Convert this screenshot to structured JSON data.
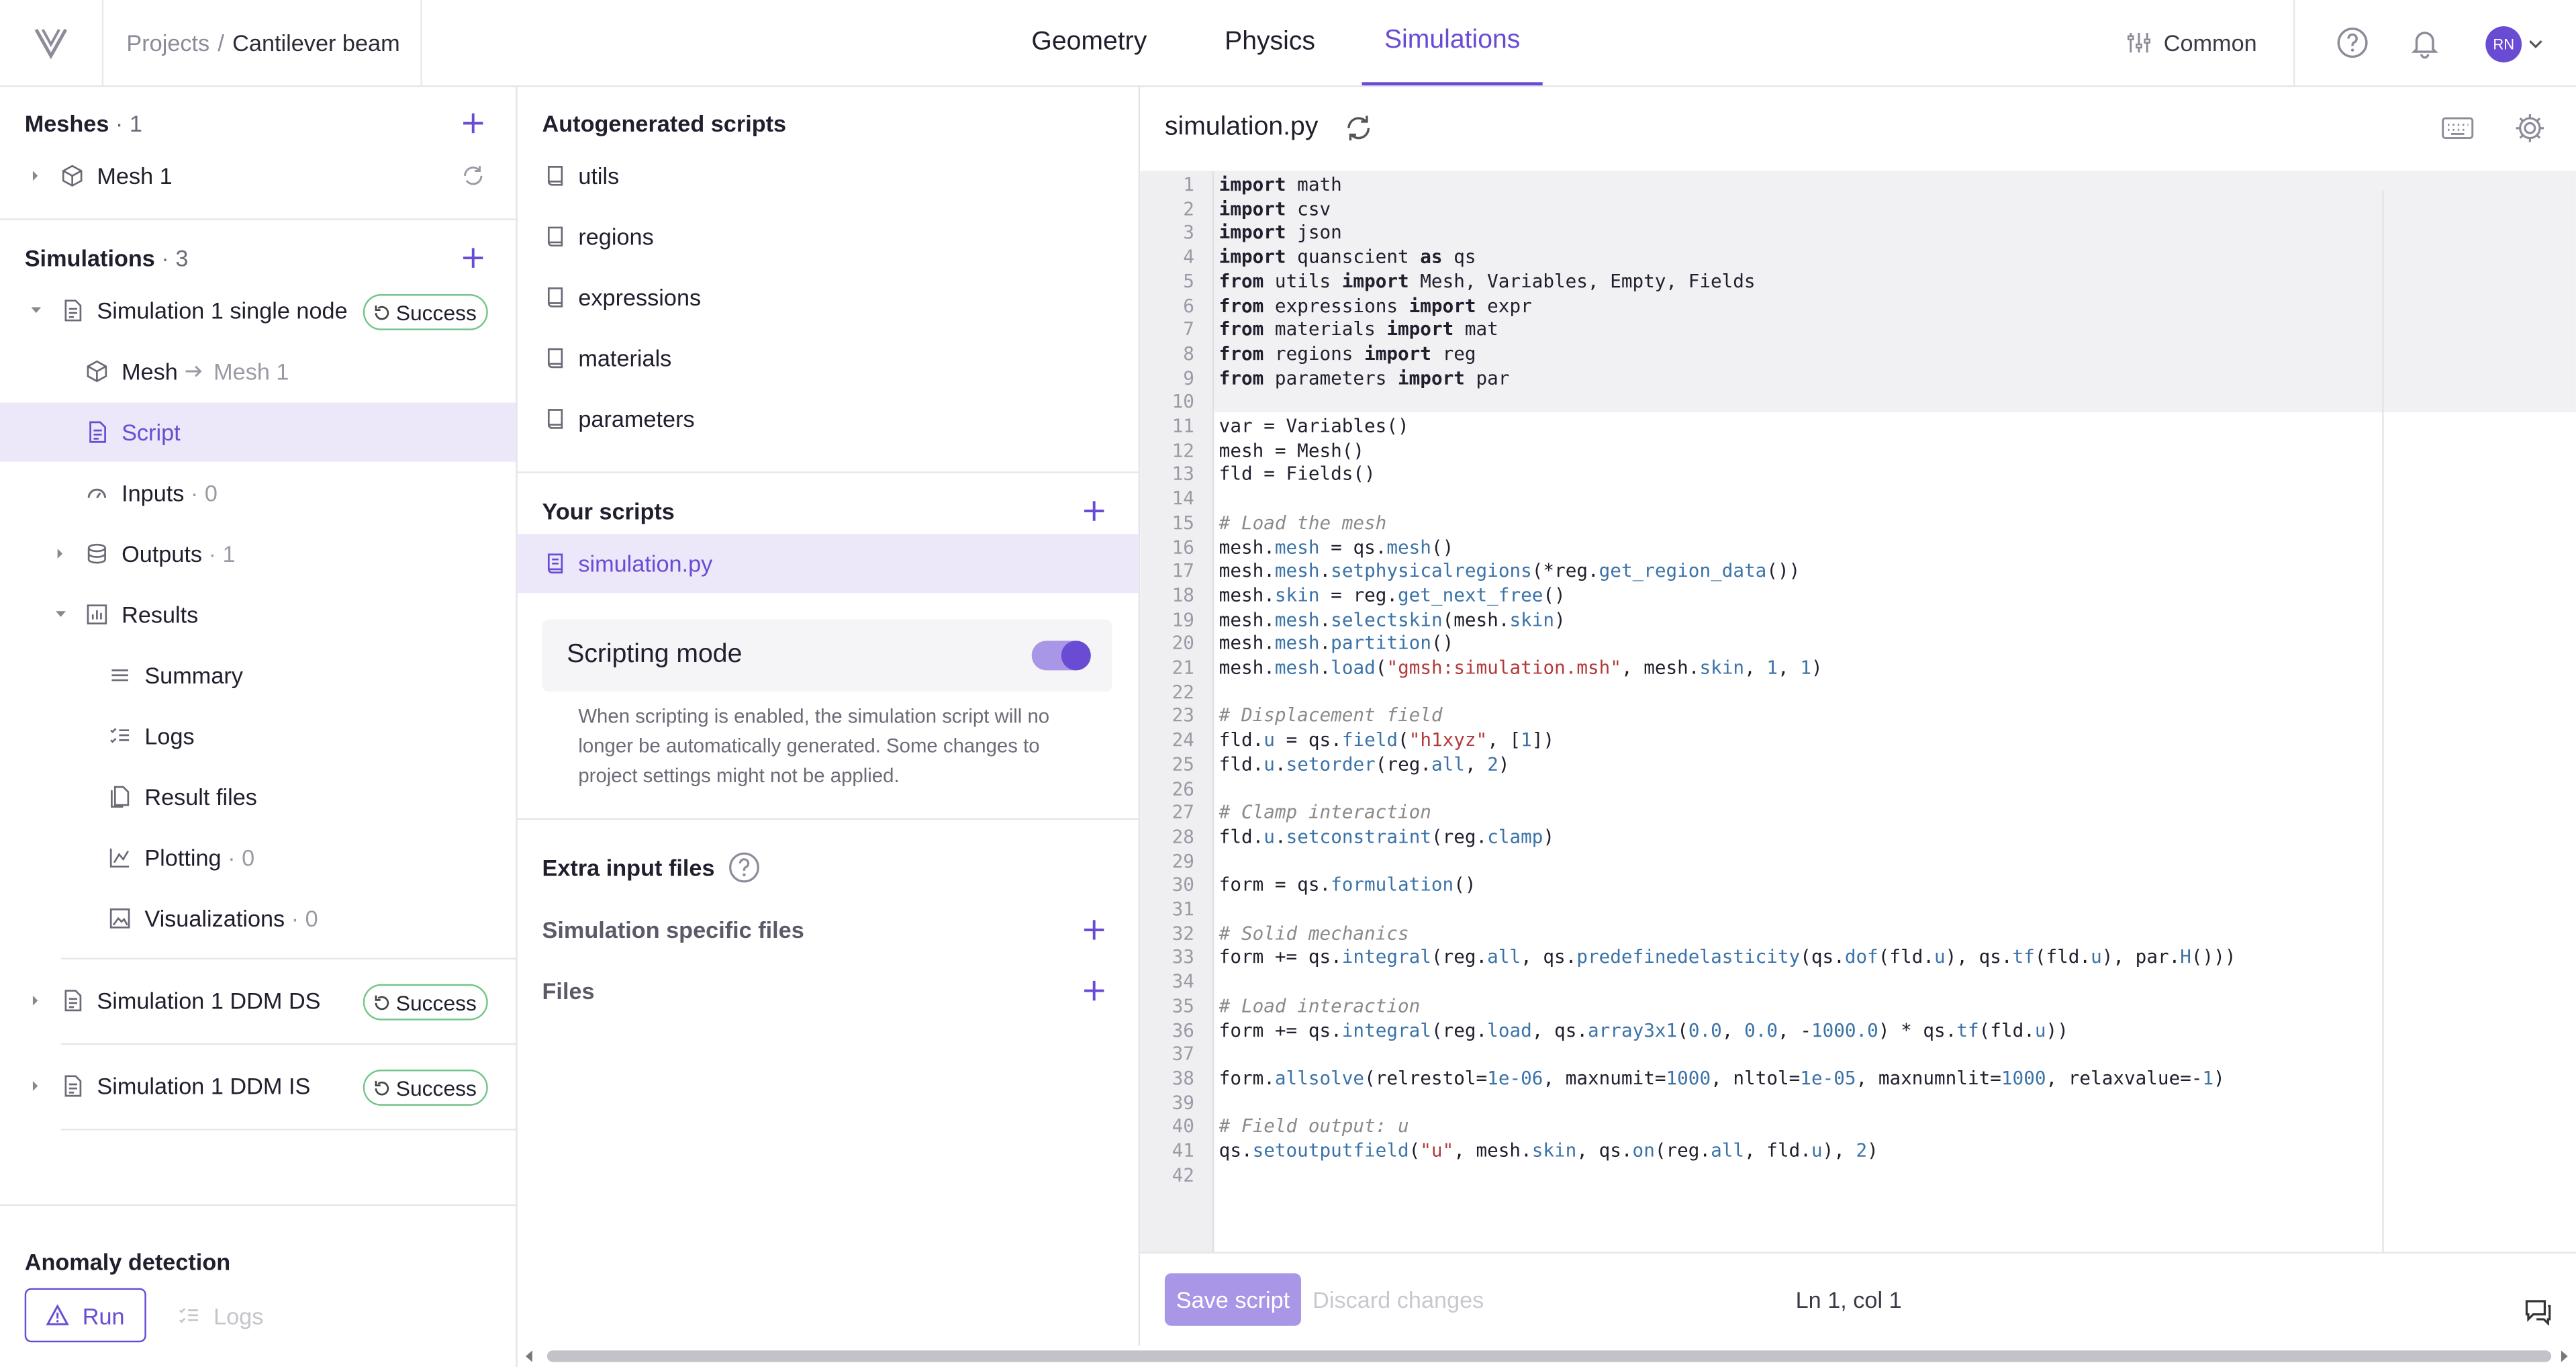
{
  "header": {
    "breadcrumb_root": "Projects",
    "breadcrumb_sep": "/",
    "breadcrumb_current": "Cantilever beam",
    "tabs": [
      "Geometry",
      "Physics",
      "Simulations"
    ],
    "active_tab": "Simulations",
    "common_label": "Common",
    "avatar_initials": "RN"
  },
  "left": {
    "meshes_title": "Meshes",
    "meshes_count": "· 1",
    "mesh_item": "Mesh 1",
    "simulations_title": "Simulations",
    "simulations_count": "· 3",
    "sim1": {
      "label": "Simulation 1 single node",
      "status": "Success",
      "mesh_label": "Mesh",
      "mesh_ref": "Mesh 1",
      "script_label": "Script",
      "inputs_label": "Inputs",
      "inputs_count": "· 0",
      "outputs_label": "Outputs",
      "outputs_count": "· 1",
      "results_label": "Results",
      "results_items": {
        "summary": "Summary",
        "logs": "Logs",
        "result_files": "Result files",
        "plotting": "Plotting",
        "plotting_count": "· 0",
        "visualizations": "Visualizations",
        "visualizations_count": "· 0"
      }
    },
    "sim2": {
      "label": "Simulation 1 DDM DS",
      "status": "Success"
    },
    "sim3": {
      "label": "Simulation 1 DDM IS",
      "status": "Success"
    },
    "anomaly_title": "Anomaly detection",
    "run_label": "Run",
    "logs_label": "Logs"
  },
  "middle": {
    "autogen_title": "Autogenerated scripts",
    "autogen_items": [
      "utils",
      "regions",
      "expressions",
      "materials",
      "parameters"
    ],
    "your_scripts_title": "Your scripts",
    "your_script_item": "simulation.py",
    "scripting_mode_label": "Scripting mode",
    "scripting_mode_on": true,
    "scripting_help": "When scripting is enabled, the simulation script will no longer be automatically generated. Some changes to project settings might not be applied.",
    "extra_title": "Extra input files",
    "sim_specific_files": "Simulation specific files",
    "files_label": "Files"
  },
  "editor": {
    "filename": "simulation.py",
    "save_label": "Save script",
    "discard_label": "Discard changes",
    "cursor_pos": "Ln 1, col 1",
    "lines": [
      "import math",
      "import csv",
      "import json",
      "import quanscient as qs",
      "from utils import Mesh, Variables, Empty, Fields",
      "from expressions import expr",
      "from materials import mat",
      "from regions import reg",
      "from parameters import par",
      "",
      "var = Variables()",
      "mesh = Mesh()",
      "fld = Fields()",
      "",
      "# Load the mesh",
      "mesh.mesh = qs.mesh()",
      "mesh.mesh.setphysicalregions(*reg.get_region_data())",
      "mesh.skin = reg.get_next_free()",
      "mesh.mesh.selectskin(mesh.skin)",
      "mesh.mesh.partition()",
      "mesh.mesh.load(\"gmsh:simulation.msh\", mesh.skin, 1, 1)",
      "",
      "# Displacement field",
      "fld.u = qs.field(\"h1xyz\", [1])",
      "fld.u.setorder(reg.all, 2)",
      "",
      "# Clamp interaction",
      "fld.u.setconstraint(reg.clamp)",
      "",
      "form = qs.formulation()",
      "",
      "# Solid mechanics",
      "form += qs.integral(reg.all, qs.predefinedelasticity(qs.dof(fld.u), qs.tf(fld.u), par.H()))",
      "",
      "# Load interaction",
      "form += qs.integral(reg.load, qs.array3x1(0.0, 0.0, -1000.0) * qs.tf(fld.u))",
      "",
      "form.allsolve(relrestol=1e-06, maxnumit=1000, nltol=1e-05, maxnumnlit=1000, relaxvalue=-1)",
      "",
      "# Field output: u",
      "qs.setoutputfield(\"u\", mesh.skin, qs.on(reg.all, fld.u), 2)",
      ""
    ]
  },
  "colors": {
    "accent": "#6a4bd4",
    "selection_bg": "#ece8fa",
    "success_border": "#74c58a"
  }
}
